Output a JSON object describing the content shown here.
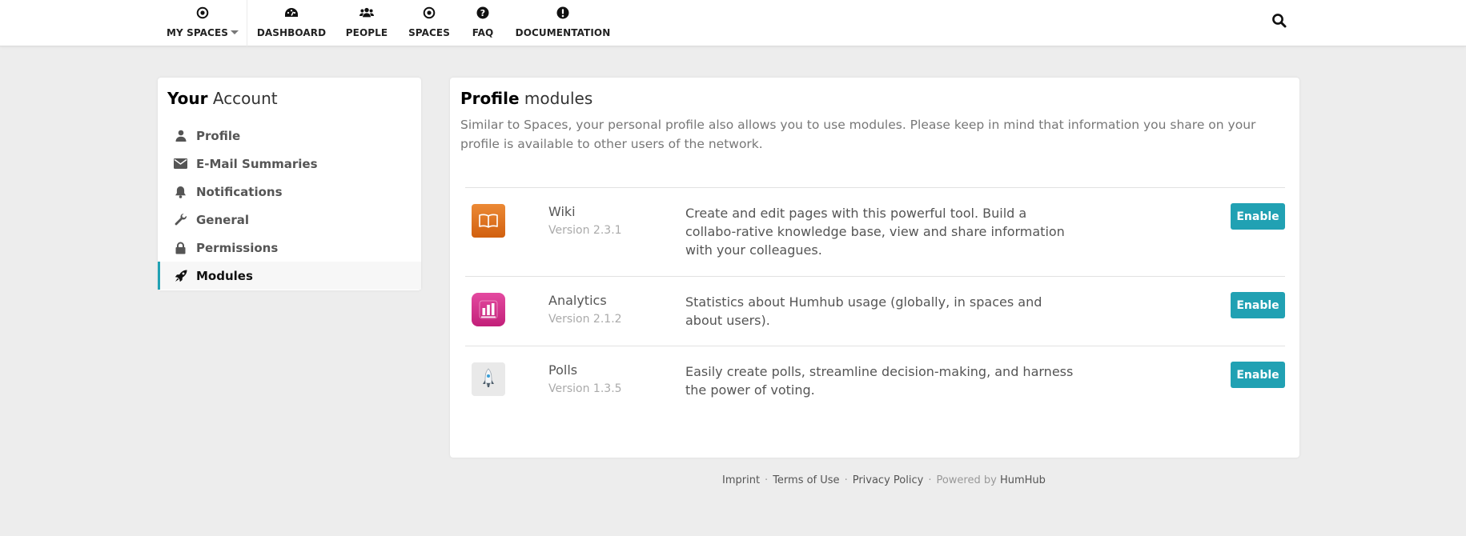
{
  "nav": {
    "items": [
      {
        "label": "MY SPACES",
        "icon": "dot-circle-icon"
      },
      {
        "label": "DASHBOARD",
        "icon": "dashboard-icon"
      },
      {
        "label": "PEOPLE",
        "icon": "users-icon"
      },
      {
        "label": "SPACES",
        "icon": "dot-circle-icon"
      },
      {
        "label": "FAQ",
        "icon": "question-circle-icon"
      },
      {
        "label": "DOCUMENTATION",
        "icon": "exclamation-circle-icon"
      }
    ],
    "search_icon": "search-icon"
  },
  "sidebar": {
    "title_bold": "Your",
    "title_rest": " Account",
    "items": [
      {
        "label": "Profile",
        "icon": "user-icon"
      },
      {
        "label": "E-Mail Summaries",
        "icon": "envelope-icon"
      },
      {
        "label": "Notifications",
        "icon": "bell-icon"
      },
      {
        "label": "General",
        "icon": "wrench-icon"
      },
      {
        "label": "Permissions",
        "icon": "lock-icon"
      },
      {
        "label": "Modules",
        "icon": "rocket-icon",
        "active": true
      }
    ]
  },
  "main": {
    "title_bold": "Profile",
    "title_rest": " modules",
    "description": "Similar to Spaces, your personal profile also allows you to use modules. Please keep in mind that information you share on your profile is available to other users of the network.",
    "modules": [
      {
        "name": "Wiki",
        "version": "Version 2.3.1",
        "description": "Create and edit pages with this powerful tool. Build a collabo-rative knowledge base, view and share information with your colleagues.",
        "button": "Enable",
        "icon": "book-icon",
        "icon_color": "#e0711f"
      },
      {
        "name": "Analytics",
        "version": "Version 2.1.2",
        "description": "Statistics about Humhub usage (globally, in spaces and about users).",
        "button": "Enable",
        "icon": "bar-chart-icon",
        "icon_color": "#d4308a"
      },
      {
        "name": "Polls",
        "version": "Version 1.3.5",
        "description": "Easily create polls, streamline decision-making, and harness the power of voting.",
        "button": "Enable",
        "icon": "rocket-icon",
        "icon_color": "#e8e8e8"
      }
    ]
  },
  "footer": {
    "links": [
      "Imprint",
      "Terms of Use",
      "Privacy Policy"
    ],
    "powered_prefix": "Powered by ",
    "powered_name": "HumHub"
  },
  "colors": {
    "accent": "#21a1b3",
    "background": "#ededed"
  }
}
